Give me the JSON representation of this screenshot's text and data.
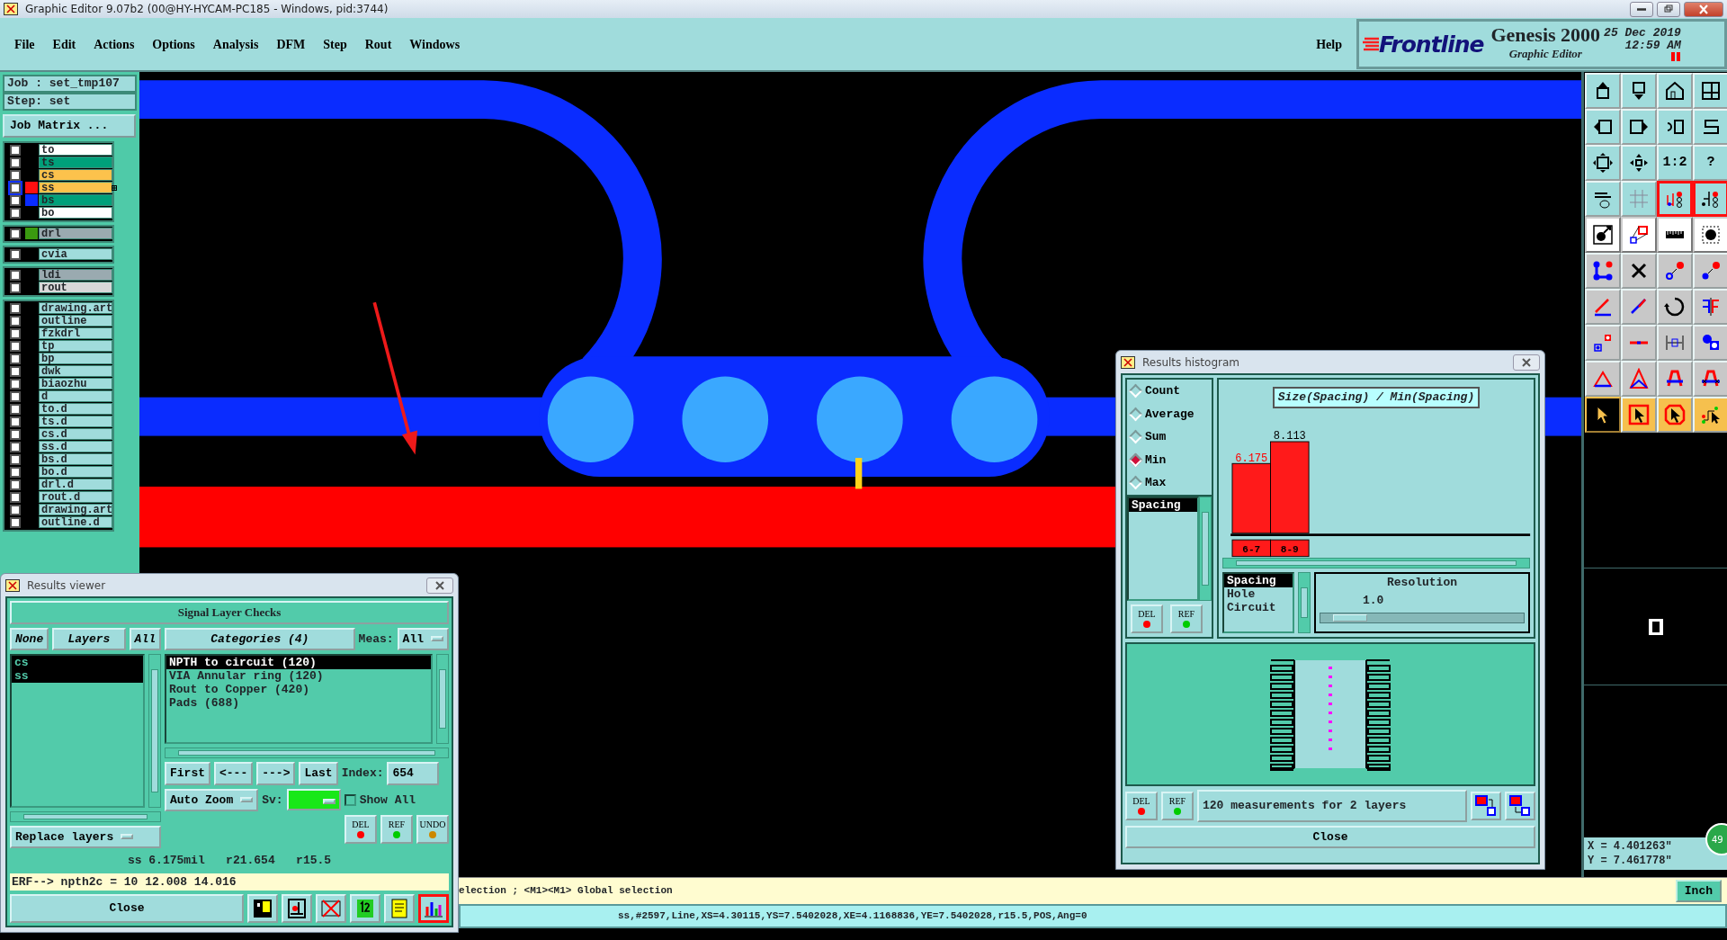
{
  "window": {
    "title": "Graphic Editor 9.07b2 (00@HY-HYCAM-PC185 - Windows, pid:3744)"
  },
  "menu": [
    "File",
    "Edit",
    "Actions",
    "Options",
    "Analysis",
    "DFM",
    "Step",
    "Rout",
    "Windows"
  ],
  "help": "Help",
  "brand": {
    "logo": "Frontline",
    "product": "Genesis 2000",
    "subtitle": "Graphic Editor",
    "date": "25 Dec 2019",
    "time": "12:59 AM"
  },
  "job": {
    "job": "Job : set_tmp107",
    "step": "Step: set",
    "matrix_button": "Job Matrix ..."
  },
  "layer_groups": [
    {
      "layers": [
        {
          "name": "to",
          "kind": "silk",
          "checked": false
        },
        {
          "name": "ts",
          "kind": "mask",
          "checked": false
        },
        {
          "name": "cs",
          "kind": "signal",
          "checked": false
        },
        {
          "name": "ss",
          "kind": "signal",
          "color": "#ff1010",
          "checked": false,
          "work": true
        },
        {
          "name": "bs",
          "kind": "mask",
          "color": "#0a2cff",
          "checked": false
        },
        {
          "name": "bo",
          "kind": "silk",
          "checked": false
        }
      ]
    },
    {
      "layers": [
        {
          "name": "drl",
          "kind": "drill",
          "color": "#3a9a10",
          "checked": false
        }
      ]
    },
    {
      "layers": [
        {
          "name": "cvia",
          "kind": "document",
          "checked": false
        }
      ]
    },
    {
      "layers": [
        {
          "name": "ldi",
          "kind": "drill",
          "checked": false
        },
        {
          "name": "rout",
          "kind": "rout",
          "checked": false
        }
      ]
    },
    {
      "layers": [
        {
          "name": "drawing.art",
          "kind": "document",
          "checked": false
        },
        {
          "name": "outline",
          "kind": "document",
          "checked": false
        },
        {
          "name": "fzkdrl",
          "kind": "document",
          "checked": false
        },
        {
          "name": "tp",
          "kind": "document",
          "checked": false
        },
        {
          "name": "bp",
          "kind": "document",
          "checked": false
        },
        {
          "name": "dwk",
          "kind": "document",
          "checked": false
        },
        {
          "name": "biaozhu",
          "kind": "document",
          "checked": false
        },
        {
          "name": "d",
          "kind": "document",
          "checked": false
        },
        {
          "name": "to.d",
          "kind": "document",
          "checked": false
        },
        {
          "name": "ts.d",
          "kind": "document",
          "checked": false
        },
        {
          "name": "cs.d",
          "kind": "document",
          "checked": false
        },
        {
          "name": "ss.d",
          "kind": "document",
          "checked": false
        },
        {
          "name": "bs.d",
          "kind": "document",
          "checked": false
        },
        {
          "name": "bo.d",
          "kind": "document",
          "checked": false
        },
        {
          "name": "drl.d",
          "kind": "document",
          "checked": false
        },
        {
          "name": "rout.d",
          "kind": "document",
          "checked": false
        },
        {
          "name": "drawing.art",
          "kind": "document",
          "checked": false
        },
        {
          "name": "outline.d",
          "kind": "document",
          "checked": false
        }
      ]
    }
  ],
  "toolbar": {
    "buttons": [
      {
        "kind": "view",
        "on": false
      },
      {
        "kind": "view",
        "on": false
      },
      {
        "kind": "view",
        "on": false
      },
      {
        "kind": "view",
        "on": false
      },
      {
        "kind": "view",
        "on": false
      },
      {
        "kind": "view",
        "on": false
      },
      {
        "kind": "view",
        "on": false
      },
      {
        "kind": "view",
        "on": false
      },
      {
        "kind": "view",
        "on": false
      },
      {
        "kind": "view",
        "on": false
      },
      {
        "kind": "view",
        "on": false,
        "label": "1:2"
      },
      {
        "kind": "view",
        "on": false,
        "label": "?"
      },
      {
        "kind": "view",
        "on": false
      },
      {
        "kind": "view",
        "on": false
      },
      {
        "kind": "view",
        "on": true
      },
      {
        "kind": "view",
        "on": true
      },
      {
        "kind": "measure",
        "on": false
      },
      {
        "kind": "measure",
        "on": false
      },
      {
        "kind": "measure",
        "on": false
      },
      {
        "kind": "measure",
        "on": false
      },
      {
        "kind": "edit",
        "on": false
      },
      {
        "kind": "edit",
        "on": false
      },
      {
        "kind": "edit",
        "on": false
      },
      {
        "kind": "edit",
        "on": false
      },
      {
        "kind": "edit",
        "on": false
      },
      {
        "kind": "edit",
        "on": false
      },
      {
        "kind": "edit",
        "on": false
      },
      {
        "kind": "edit",
        "on": false
      },
      {
        "kind": "edit",
        "on": false
      },
      {
        "kind": "edit",
        "on": false
      },
      {
        "kind": "edit",
        "on": false
      },
      {
        "kind": "edit",
        "on": false
      },
      {
        "kind": "edit",
        "on": false
      },
      {
        "kind": "edit",
        "on": false
      },
      {
        "kind": "edit",
        "on": false
      },
      {
        "kind": "edit",
        "on": false
      }
    ],
    "select_modes": [
      {
        "selected": true
      },
      {
        "selected": false
      },
      {
        "selected": false
      },
      {
        "selected": false
      }
    ]
  },
  "coordinates": {
    "x": "X = 4.401263\"",
    "y": "Y = 7.461778\""
  },
  "side_badge": "49",
  "status": {
    "prompt": "election ; <M1><M1> Global selection",
    "units": "Inch",
    "info": "ss,#2597,Line,XS=4.30115,YS=7.5402028,XE=4.1168836,YE=7.5402028,r15.5,POS,Ang=0"
  },
  "viewer": {
    "title": "Results viewer",
    "heading": "Signal Layer Checks",
    "layer_buttons": [
      "None",
      "Layers",
      "All"
    ],
    "layers": [
      {
        "name": "cs",
        "selected": true
      },
      {
        "name": "ss",
        "selected": true
      }
    ],
    "categories_label": "Categories (4)",
    "meas_label": "Meas:",
    "meas_value": "All",
    "categories": [
      {
        "name": "NPTH to circuit (120)",
        "selected": true
      },
      {
        "name": "VIA Annular ring (120)",
        "selected": false
      },
      {
        "name": "Rout to Copper (420)",
        "selected": false
      },
      {
        "name": "Pads (688)",
        "selected": false
      }
    ],
    "nav": [
      "First",
      "<---",
      "--->",
      "Last"
    ],
    "index_label": "Index:",
    "index_value": "654",
    "zoom": "Auto Zoom",
    "sv_label": "Sv:",
    "show_all": {
      "label": "Show All",
      "checked": false
    },
    "replace": "Replace layers",
    "actions": [
      "DEL",
      "REF",
      "UNDO"
    ],
    "measurement": "ss 6.175mil   r21.654   r15.5",
    "erf": "ERF--> npth2c = 10 12.008 14.016",
    "close": "Close",
    "tools": [
      {
        "on": false
      },
      {
        "on": false
      },
      {
        "on": false
      },
      {
        "on": false
      },
      {
        "on": false
      },
      {
        "on": true
      }
    ]
  },
  "histogram": {
    "title": "Results histogram",
    "modes": [
      {
        "label": "Count",
        "selected": false
      },
      {
        "label": "Average",
        "selected": false
      },
      {
        "label": "Sum",
        "selected": false
      },
      {
        "label": "Min",
        "selected": true
      },
      {
        "label": "Max",
        "selected": false
      }
    ],
    "types": [
      {
        "label": "Spacing",
        "selected": true
      }
    ],
    "type_actions": [
      "DEL",
      "REF"
    ],
    "chart_data": {
      "type": "bar",
      "title": "Size(Spacing) / Min(Spacing)",
      "categories": [
        "6-7",
        "8-9"
      ],
      "values": [
        6.175,
        8.113
      ],
      "data_labels": true
    },
    "kinds": [
      {
        "label": "Spacing",
        "selected": true
      },
      {
        "label": "Hole",
        "selected": false
      },
      {
        "label": "Circuit",
        "selected": false
      }
    ],
    "resolution_label": "Resolution",
    "resolution_value": "1.0",
    "resolution": {
      "level": 0.06
    },
    "actions": [
      "DEL",
      "REF"
    ],
    "summary": "120 measurements for 2 layers",
    "close": "Close"
  }
}
